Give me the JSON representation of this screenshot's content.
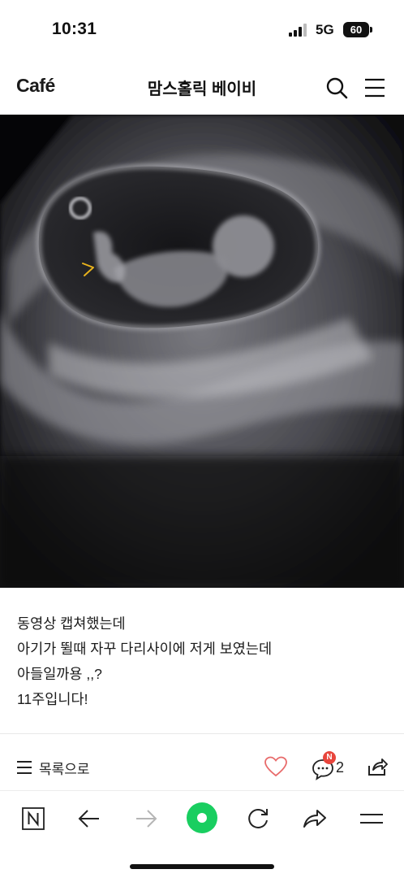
{
  "status_bar": {
    "time": "10:31",
    "network": "5G",
    "battery": "60"
  },
  "header": {
    "logo": "Café",
    "title": "맘스홀릭 베이비",
    "icons": [
      "search-icon",
      "hamburger-menu-icon"
    ]
  },
  "post": {
    "image_description": "ultrasound-scan",
    "lines": [
      "동영상 캡쳐했는데",
      "아기가 뛸때 자꾸 다리사이에 저게 보였는데",
      "아들일까용 ,,?",
      "11주입니다!"
    ]
  },
  "actions": {
    "list_label": "목록으로",
    "comment_count": "2",
    "new_badge": "N",
    "colors": {
      "heart": "#e86b6b",
      "badge": "#e8453c"
    }
  },
  "browser_toolbar": {
    "icons": [
      "naver-n-icon",
      "back-arrow-icon",
      "forward-arrow-icon",
      "green-dot-icon",
      "reload-icon",
      "share-arrow-icon",
      "menu-icon"
    ],
    "accent": "#19ce60"
  }
}
